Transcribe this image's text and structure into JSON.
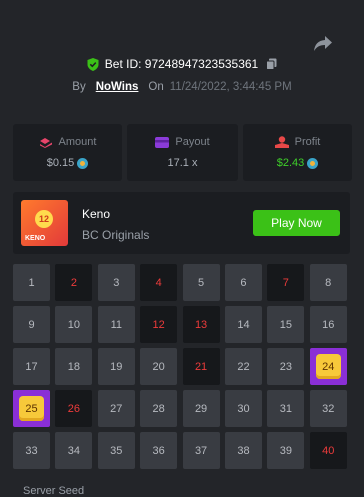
{
  "header": {
    "bet_label": "Bet ID: 97248947323535361",
    "by_label": "By",
    "user": "NoWins",
    "on_label": "On",
    "date": "11/24/2022, 3:44:45 PM"
  },
  "stats": {
    "amount": {
      "label": "Amount",
      "value": "$0.15"
    },
    "payout": {
      "label": "Payout",
      "value": "17.1 x"
    },
    "profit": {
      "label": "Profit",
      "value": "$2.43"
    }
  },
  "game": {
    "thumb_ball": "12",
    "thumb_label": "KENO",
    "name": "Keno",
    "provider": "BC Originals",
    "play_label": "Play Now"
  },
  "grid": {
    "numbers": [
      "1",
      "2",
      "3",
      "4",
      "5",
      "6",
      "7",
      "8",
      "9",
      "10",
      "11",
      "12",
      "13",
      "14",
      "15",
      "16",
      "17",
      "18",
      "19",
      "20",
      "21",
      "22",
      "23",
      "24",
      "25",
      "26",
      "27",
      "28",
      "29",
      "30",
      "31",
      "32",
      "33",
      "34",
      "35",
      "36",
      "37",
      "38",
      "39",
      "40"
    ],
    "drawn": [
      "2",
      "4",
      "7",
      "12",
      "13",
      "21",
      "26",
      "40"
    ],
    "hits": [
      "24",
      "25"
    ]
  },
  "footer": {
    "server_seed_label": "Server Seed"
  },
  "colors": {
    "accent_green": "#3bc117",
    "hit_purple": "#8a2fd6",
    "gem_yellow": "#f7c93a",
    "drawn_red": "#ed3b3b"
  }
}
